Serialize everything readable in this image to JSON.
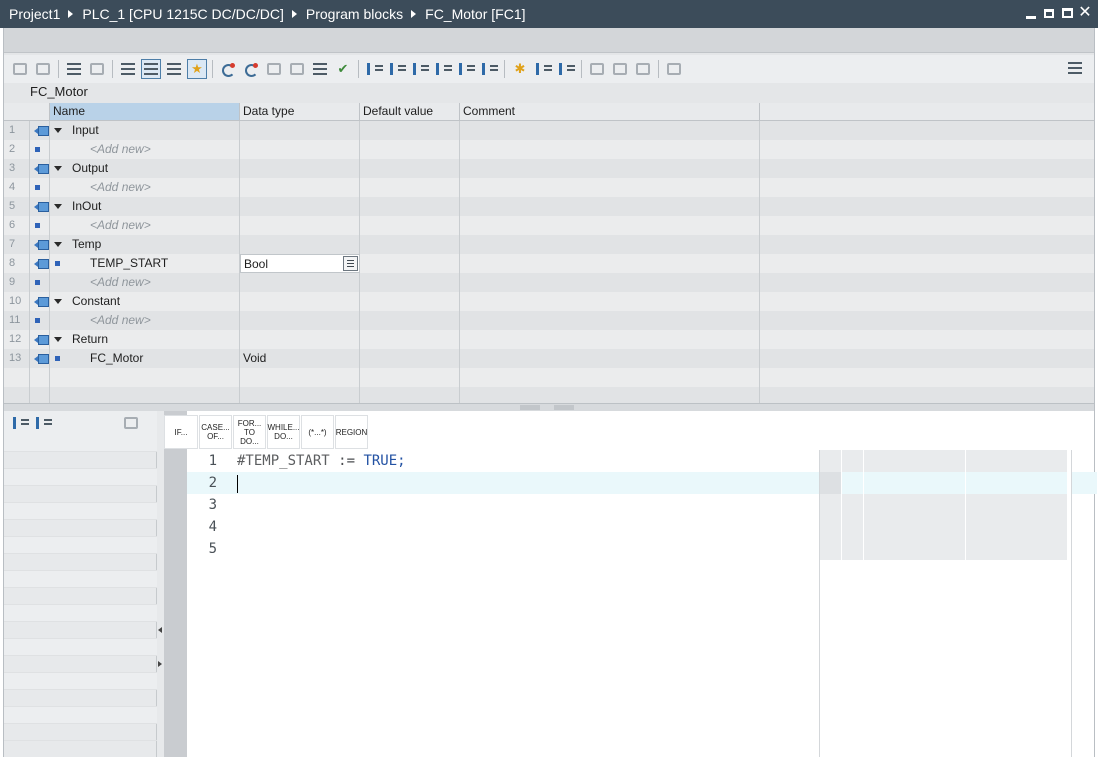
{
  "window": {
    "breadcrumb": [
      "Project1",
      "PLC_1 [CPU 1215C DC/DC/DC]",
      "Program blocks",
      "FC_Motor [FC1]"
    ]
  },
  "block": {
    "title": "FC_Motor"
  },
  "interface": {
    "columns": {
      "name": "Name",
      "data_type": "Data type",
      "default_value": "Default value",
      "comment": "Comment"
    },
    "rows": [
      {
        "num": "1",
        "label": "Input",
        "type": ""
      },
      {
        "num": "2",
        "label": "<Add new>",
        "type": ""
      },
      {
        "num": "3",
        "label": "Output",
        "type": ""
      },
      {
        "num": "4",
        "label": "<Add new>",
        "type": ""
      },
      {
        "num": "5",
        "label": "InOut",
        "type": ""
      },
      {
        "num": "6",
        "label": "<Add new>",
        "type": ""
      },
      {
        "num": "7",
        "label": "Temp",
        "type": ""
      },
      {
        "num": "8",
        "label": "TEMP_START",
        "type": "Bool"
      },
      {
        "num": "9",
        "label": "<Add new>",
        "type": ""
      },
      {
        "num": "10",
        "label": "Constant",
        "type": ""
      },
      {
        "num": "11",
        "label": "<Add new>",
        "type": ""
      },
      {
        "num": "12",
        "label": "Return",
        "type": ""
      },
      {
        "num": "13",
        "label": "FC_Motor",
        "type": "Void"
      }
    ]
  },
  "editor": {
    "keywords": [
      "IF...",
      "CASE... OF...",
      "FOR... TO DO...",
      "WHILE... DO...",
      "(*...*)",
      "REGION"
    ],
    "lines": [
      {
        "num": "1",
        "var": "#TEMP_START",
        "op": ":=",
        "val": "TRUE;"
      },
      {
        "num": "2"
      },
      {
        "num": "3"
      },
      {
        "num": "4"
      },
      {
        "num": "5"
      }
    ]
  }
}
